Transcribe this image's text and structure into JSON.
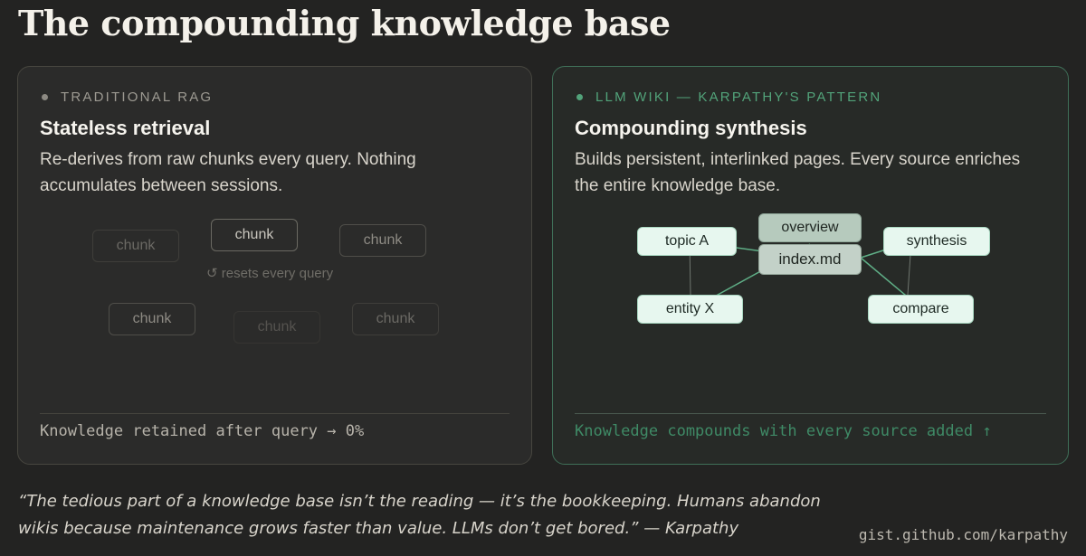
{
  "title": "The compounding knowledge base",
  "left_card": {
    "label": "TRADITIONAL RAG",
    "heading": "Stateless retrieval",
    "description": "Re-derives from raw chunks every query. Nothing accumulates between sessions.",
    "chunks": [
      "chunk",
      "chunk",
      "chunk",
      "chunk",
      "chunk",
      "chunk"
    ],
    "reset_note": "↺ resets every query",
    "footer": "Knowledge retained after query → 0%"
  },
  "right_card": {
    "label": "LLM WIKI — KARPATHY'S PATTERN",
    "heading": "Compounding synthesis",
    "description": "Builds persistent, interlinked pages. Every source enriches the entire knowledge base.",
    "nodes": {
      "overview": "overview",
      "index": "index.md",
      "topic_a": "topic A",
      "synthesis": "synthesis",
      "entity_x": "entity X",
      "compare": "compare"
    },
    "footer": "Knowledge compounds with every source added ↑"
  },
  "quote": "“The tedious part of a knowledge base isn’t the reading — it’s the bookkeeping. Humans abandon wikis because maintenance grows faster than value. LLMs don’t get bored.” — Karpathy",
  "source": "gist.github.com/karpathy",
  "colors": {
    "background": "#232322",
    "accent_green": "#52a37a",
    "node_fill": "#e7f7ef"
  }
}
